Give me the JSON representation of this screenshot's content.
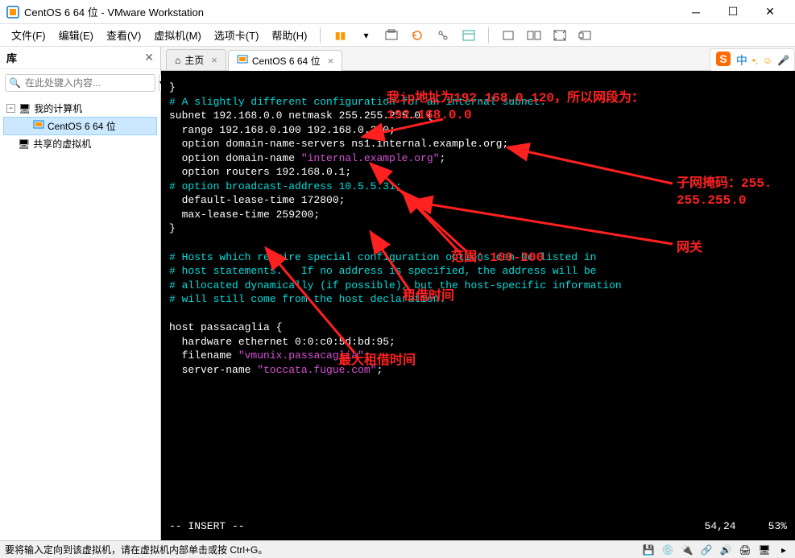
{
  "window": {
    "title": "CentOS 6 64 位 - VMware Workstation"
  },
  "menu": {
    "file": "文件(F)",
    "edit": "编辑(E)",
    "view": "查看(V)",
    "vm": "虚拟机(M)",
    "tabs": "选项卡(T)",
    "help": "帮助(H)"
  },
  "sidebar": {
    "title": "库",
    "search_placeholder": "在此处键入内容...",
    "nodes": {
      "root": "我的计算机",
      "vm": "CentOS 6 64 位",
      "shared": "共享的虚拟机"
    }
  },
  "tabs": {
    "home": "主页",
    "vm": "CentOS 6 64 位"
  },
  "terminal": {
    "lines": [
      {
        "t": "normal",
        "txt": "}"
      },
      {
        "t": "comment",
        "txt": "# A slightly different configuration for an internal subnet."
      },
      {
        "t": "mixed",
        "parts": [
          {
            "c": "normal",
            "v": "subnet 192.168.0.0 netmask 255.255.255.0 {"
          }
        ]
      },
      {
        "t": "normal",
        "txt": "  range 192.168.0.100 192.168.0.200;"
      },
      {
        "t": "normal",
        "txt": "  option domain-name-servers ns1.internal.example.org;"
      },
      {
        "t": "mixed",
        "parts": [
          {
            "c": "normal",
            "v": "  option domain-name "
          },
          {
            "c": "string",
            "v": "\"internal.example.org\""
          },
          {
            "c": "normal",
            "v": ";"
          }
        ]
      },
      {
        "t": "normal",
        "txt": "  option routers 192.168.0.1;"
      },
      {
        "t": "comment",
        "txt": "# option broadcast-address 10.5.5.31;"
      },
      {
        "t": "normal",
        "txt": "  default-lease-time 172800;"
      },
      {
        "t": "normal",
        "txt": "  max-lease-time 259200;"
      },
      {
        "t": "normal",
        "txt": "}"
      },
      {
        "t": "blank",
        "txt": ""
      },
      {
        "t": "comment",
        "txt": "# Hosts which require special configuration options can be listed in"
      },
      {
        "t": "comment",
        "txt": "# host statements.   If no address is specified, the address will be"
      },
      {
        "t": "comment",
        "txt": "# allocated dynamically (if possible), but the host-specific information"
      },
      {
        "t": "comment",
        "txt": "# will still come from the host declaration."
      },
      {
        "t": "blank",
        "txt": ""
      },
      {
        "t": "normal",
        "txt": "host passacaglia {"
      },
      {
        "t": "normal",
        "txt": "  hardware ethernet 0:0:c0:5d:bd:95;"
      },
      {
        "t": "mixed",
        "parts": [
          {
            "c": "normal",
            "v": "  filename "
          },
          {
            "c": "string",
            "v": "\"vmunix.passacaglia\""
          },
          {
            "c": "normal",
            "v": ";"
          }
        ]
      },
      {
        "t": "mixed",
        "parts": [
          {
            "c": "normal",
            "v": "  server-name "
          },
          {
            "c": "string",
            "v": "\"toccata.fugue.com\""
          },
          {
            "c": "normal",
            "v": ";"
          }
        ]
      }
    ],
    "mode": "-- INSERT --",
    "cursor_pos": "54,24",
    "scroll_pct": "53%"
  },
  "annotations": {
    "ip_note": "我ip地址为192.168.0.120，所以网段为：\n192.168.0.0",
    "netmask": "子网掩码：255.\n255.255.0",
    "gateway": "网关",
    "range": "范围：100-200",
    "lease": "租借时间",
    "max_lease": "最大租借时间"
  },
  "statusbar": {
    "text": "要将输入定向到该虚拟机，请在虚拟机内部单击或按 Ctrl+G。"
  },
  "ime": {
    "lang": "中"
  }
}
